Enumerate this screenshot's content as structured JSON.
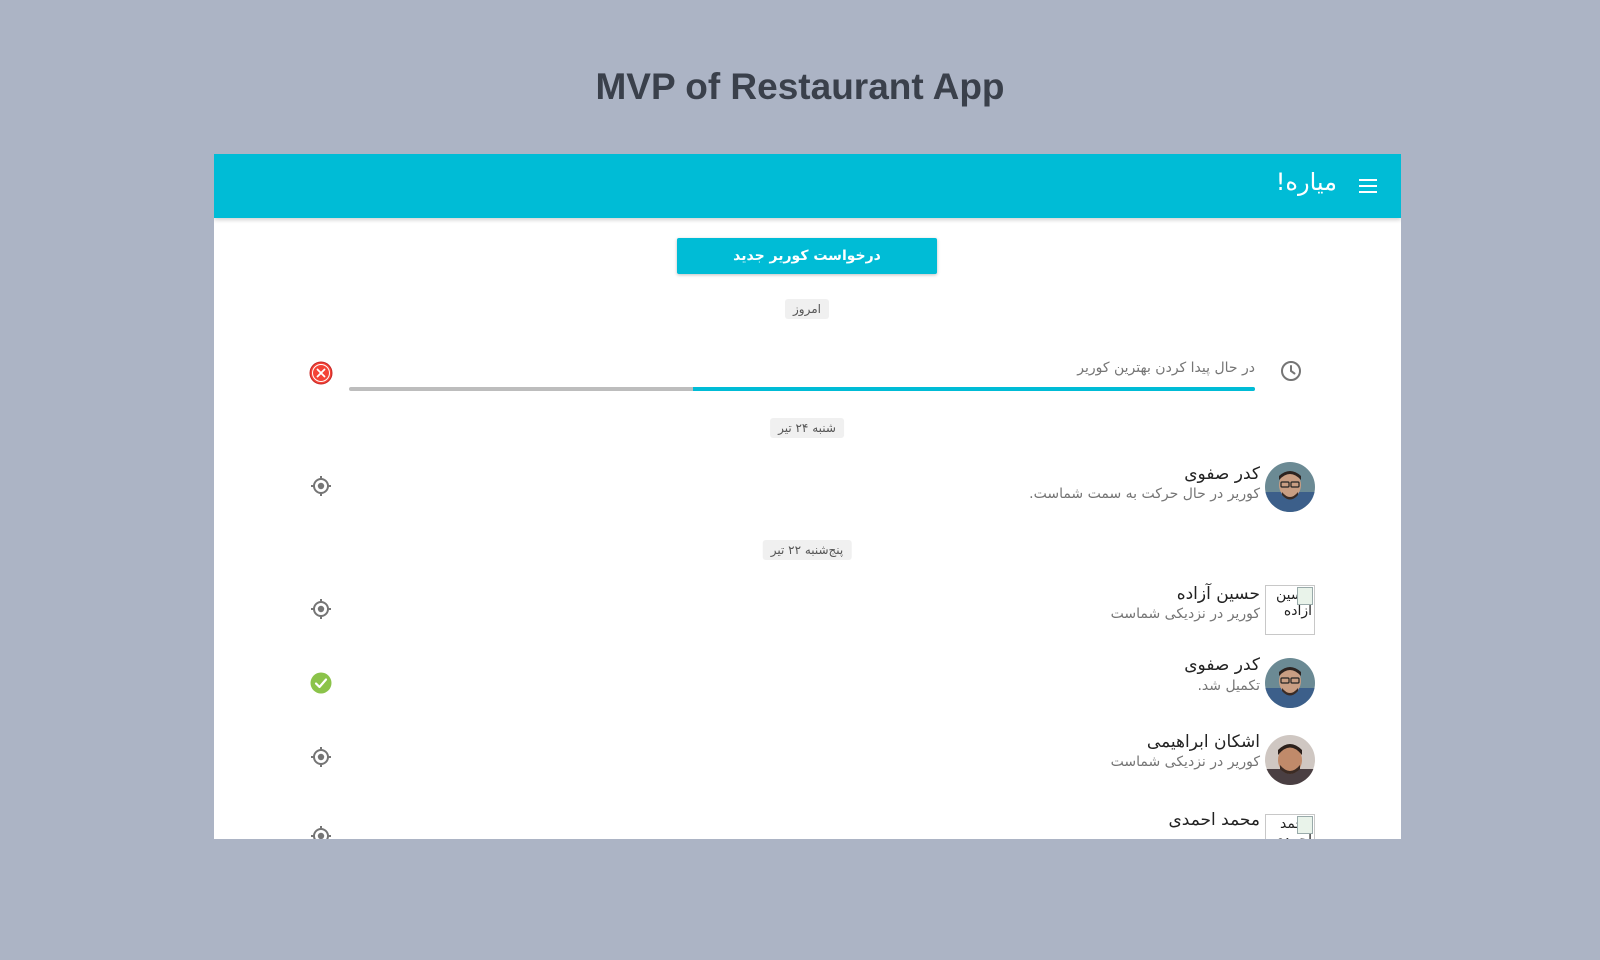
{
  "page": {
    "title": "MVP of Restaurant App"
  },
  "app_bar": {
    "title": "میاره!",
    "menu_icon": "hamburger-menu-icon"
  },
  "actions": {
    "new_courier_label": "درخواست کوریر جدید"
  },
  "colors": {
    "primary": "#00bcd6",
    "cancel": "#f44336",
    "success": "#8bc34a",
    "background": "#acb4c5"
  },
  "today": {
    "date_label": "امروز",
    "status_text": "در حال پیدا کردن بهترین کوریر",
    "progress": 0.62,
    "status_icon": "clock-icon",
    "action_icon": "cancel-icon"
  },
  "groups": [
    {
      "date_label": "شنبه ۲۴ تیر",
      "items": [
        {
          "name": "کدر صفوی",
          "status": "کوریر در حال حرکت به سمت شماست.",
          "avatar": "photo",
          "icon": "locate-icon"
        }
      ]
    },
    {
      "date_label": "پنج‌شنبه ۲۲ تیر",
      "items": [
        {
          "name": "حسین آزاده",
          "status": "کوریر در نزدیکی شماست",
          "avatar": "broken",
          "avatar_alt": "حسین آزاده",
          "icon": "locate-icon"
        },
        {
          "name": "کدر صفوی",
          "status": "تکمیل شد.",
          "avatar": "photo",
          "icon": "check-circle-icon"
        },
        {
          "name": "اشکان ابراهیمی",
          "status": "کوریر در نزدیکی شماست",
          "avatar": "photo",
          "icon": "locate-icon"
        },
        {
          "name": "محمد احمدی",
          "status": "",
          "avatar": "broken",
          "avatar_alt": "محمد احمدی",
          "icon": "locate-icon"
        }
      ]
    }
  ]
}
